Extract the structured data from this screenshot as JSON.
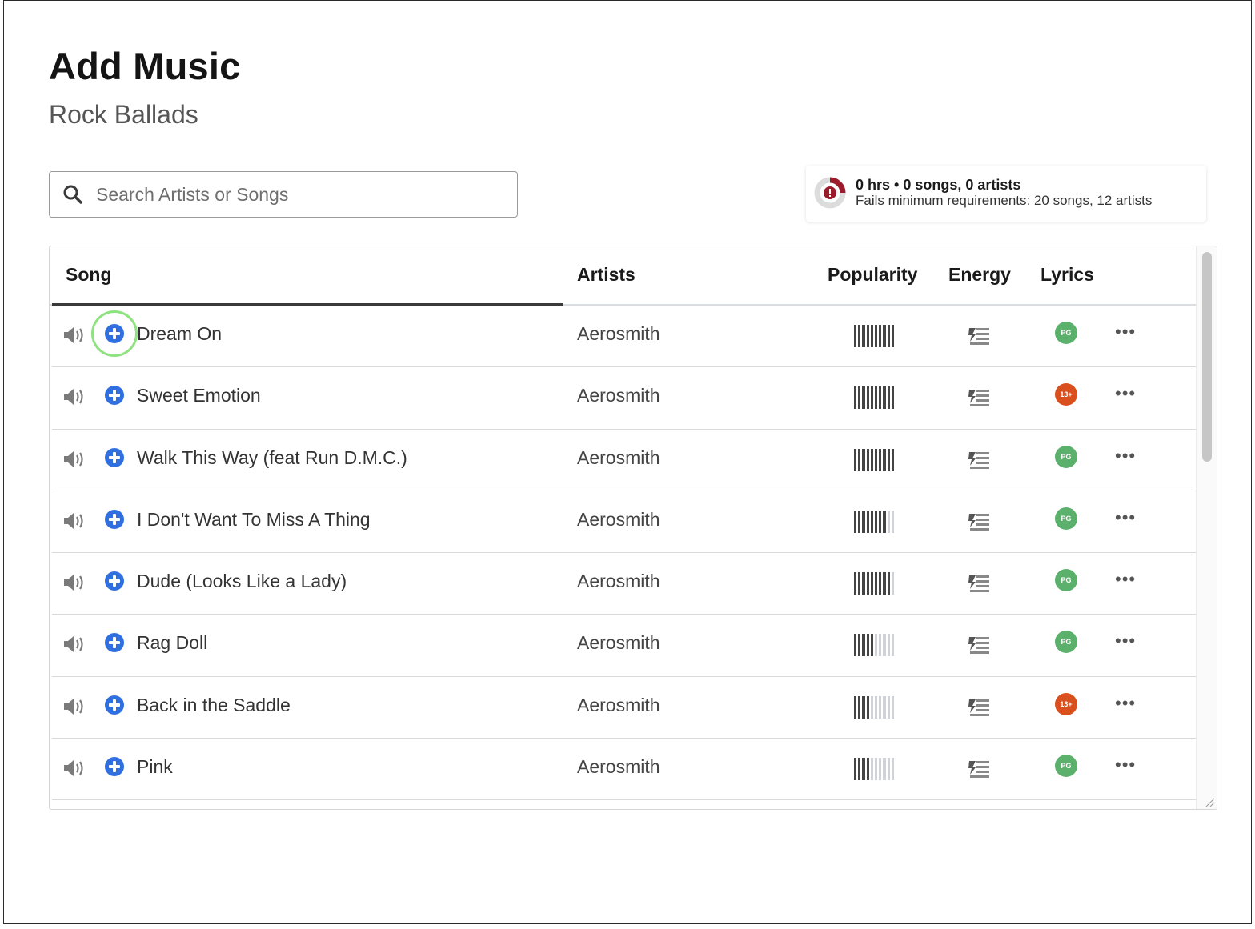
{
  "header": {
    "title": "Add Music",
    "subtitle": "Rock Ballads"
  },
  "search": {
    "placeholder": "Search Artists or Songs",
    "icon": "search-icon"
  },
  "summary": {
    "line1": "0 hrs • 0 songs, 0 artists",
    "line2": "Fails minimum requirements: 20 songs, 12 artists",
    "status_color": "#9b1b2a",
    "ring_icon": "warning-ring-icon"
  },
  "table": {
    "columns": {
      "song": "Song",
      "artists": "Artists",
      "popularity": "Popularity",
      "energy": "Energy",
      "lyrics": "Lyrics"
    },
    "rows": [
      {
        "title": "Dream On",
        "artist": "Aerosmith",
        "popularity": 10,
        "lyrics": "PG"
      },
      {
        "title": "Sweet Emotion",
        "artist": "Aerosmith",
        "popularity": 10,
        "lyrics": "13+"
      },
      {
        "title": "Walk This Way (feat Run D.M.C.)",
        "artist": "Aerosmith",
        "popularity": 10,
        "lyrics": "PG"
      },
      {
        "title": "I Don't Want To Miss A Thing",
        "artist": "Aerosmith",
        "popularity": 8,
        "lyrics": "PG"
      },
      {
        "title": "Dude (Looks Like a Lady)",
        "artist": "Aerosmith",
        "popularity": 9,
        "lyrics": "PG"
      },
      {
        "title": "Rag Doll",
        "artist": "Aerosmith",
        "popularity": 5,
        "lyrics": "PG"
      },
      {
        "title": "Back in the Saddle",
        "artist": "Aerosmith",
        "popularity": 4,
        "lyrics": "13+"
      },
      {
        "title": "Pink",
        "artist": "Aerosmith",
        "popularity": 4,
        "lyrics": "PG"
      }
    ],
    "popularity_max": 10,
    "more_label": "•••"
  },
  "colors": {
    "accent": "#2f6fe0",
    "pg": "#5bb06c",
    "teen": "#d9501e",
    "focus": "#8ee27f"
  },
  "icons": {
    "speaker": "speaker-icon",
    "add": "add-circle-icon",
    "energy": "energy-icon",
    "more": "more-icon"
  }
}
